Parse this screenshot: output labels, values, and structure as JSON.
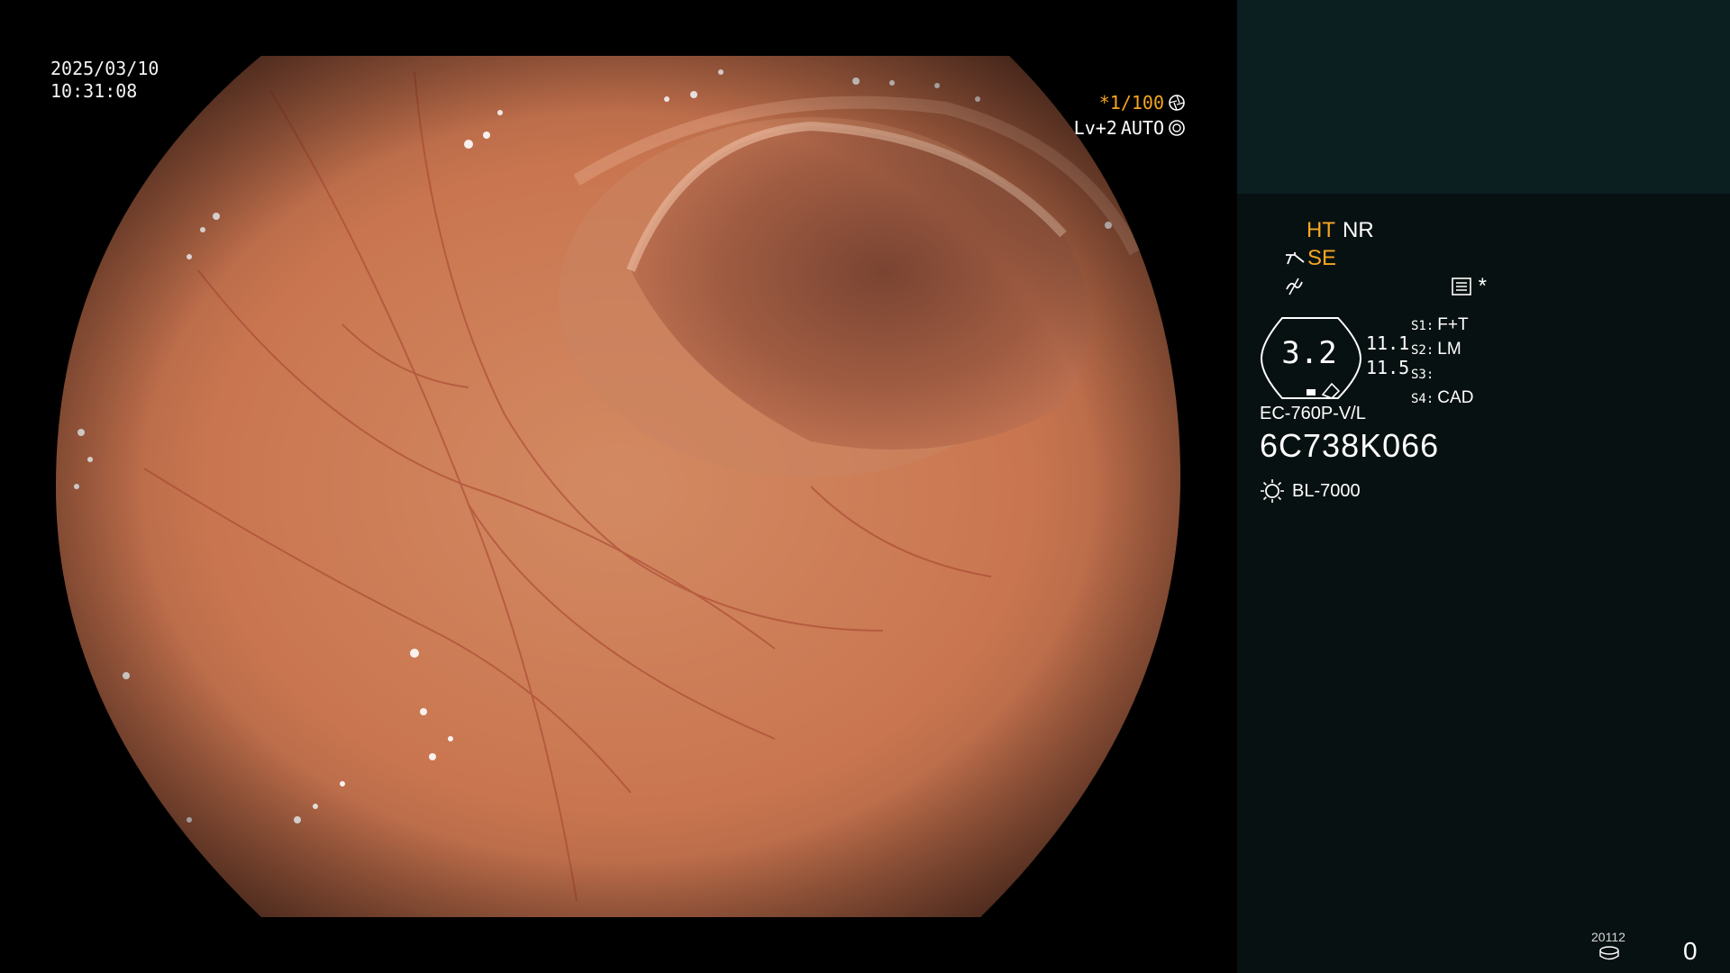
{
  "datetime": {
    "date": "2025/03/10",
    "time": "10:31:08"
  },
  "shutter": {
    "speed": "*1/100",
    "level": "Lv+2",
    "mode": "AUTO"
  },
  "panel": {
    "modes": {
      "ht": "HT",
      "nr": "NR",
      "se": "SE",
      "star": "*"
    },
    "gauge": {
      "value": "3.2",
      "num1": "11.1",
      "num2": "11.5"
    },
    "switches": [
      {
        "key": "S1:",
        "value": "F+T"
      },
      {
        "key": "S2:",
        "value": "LM"
      },
      {
        "key": "S3:",
        "value": ""
      },
      {
        "key": "S4:",
        "value": "CAD"
      }
    ],
    "scope_model": "EC-760P-V/L",
    "scope_serial": "6C738K066",
    "light_source": "BL-7000",
    "counter_label": "20112",
    "counter_value": "0"
  },
  "colors": {
    "accent_orange": "#f5a623",
    "panel_bg": "#081111",
    "panel_top": "#0b1f21"
  },
  "icons": [
    "shutter-aperture-icon",
    "auto-iris-icon",
    "scope-tip-icon",
    "enhance-icon",
    "menu-icon",
    "light-bulb-icon",
    "storage-disk-icon"
  ]
}
